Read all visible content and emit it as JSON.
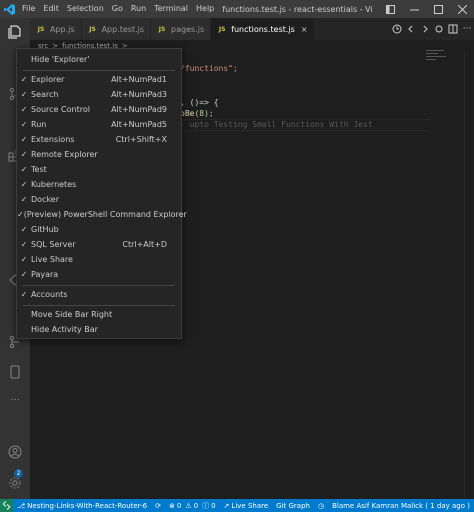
{
  "titlebar": {
    "menu": [
      "File",
      "Edit",
      "Selection",
      "Go",
      "Run",
      "Terminal",
      "Help"
    ],
    "title": "functions.test.js - react-essentials - Visual Studi...",
    "ctrl_icons": [
      "layout-icon",
      "minimize-icon",
      "maximize-icon",
      "close-icon"
    ]
  },
  "tabs": [
    {
      "label": "App.js",
      "icon": "js-icon"
    },
    {
      "label": "App.test.js",
      "icon": "js-icon"
    },
    {
      "label": "pages.js",
      "icon": "js-icon"
    },
    {
      "label": "functions.test.js",
      "icon": "js-icon",
      "active": true,
      "close": "×"
    }
  ],
  "breadcrumb": [
    "src",
    ">",
    "functions.test.js",
    ">"
  ],
  "code": {
    "line1": "/functions\";",
    "line2": ", ()=> {",
    "line3_fn": "oBe",
    "line3_rest": "(8);",
    "ghost": "- upto Testing Small Functions With Jest"
  },
  "context_menu": {
    "hide_explorer": "Hide 'Explorer'",
    "items": [
      {
        "label": "Explorer",
        "shortcut": "Alt+NumPad1",
        "checked": true
      },
      {
        "label": "Search",
        "shortcut": "Alt+NumPad3",
        "checked": true
      },
      {
        "label": "Source Control",
        "shortcut": "Alt+NumPad9",
        "checked": true
      },
      {
        "label": "Run",
        "shortcut": "Alt+NumPad5",
        "checked": true
      },
      {
        "label": "Extensions",
        "shortcut": "Ctrl+Shift+X",
        "checked": true
      },
      {
        "label": "Remote Explorer",
        "shortcut": "",
        "checked": true
      },
      {
        "label": "Test",
        "shortcut": "",
        "checked": true
      },
      {
        "label": "Kubernetes",
        "shortcut": "",
        "checked": true
      },
      {
        "label": "Docker",
        "shortcut": "",
        "checked": true
      },
      {
        "label": "(Preview) PowerShell Command Explorer",
        "shortcut": "",
        "checked": true
      },
      {
        "label": "GitHub",
        "shortcut": "",
        "checked": true
      },
      {
        "label": "SQL Server",
        "shortcut": "Ctrl+Alt+D",
        "checked": true
      },
      {
        "label": "Live Share",
        "shortcut": "",
        "checked": true
      },
      {
        "label": "Payara",
        "shortcut": "",
        "checked": true
      }
    ],
    "accounts": {
      "label": "Accounts",
      "checked": true
    },
    "move_side_bar": "Move Side Bar Right",
    "hide_activity_bar": "Hide Activity Bar",
    "check_glyph": "✓"
  },
  "activity_bar": {
    "icons": [
      "explorer-icon",
      "search-icon",
      "source-control-icon",
      "run-icon",
      "extensions-icon",
      "remote-explorer-icon",
      "test-icon",
      "kubernetes-icon",
      "docker-icon",
      "powershell-icon",
      "github-icon",
      "sql-server-icon",
      "live-share-icon",
      "payara-icon",
      "more-icon",
      "accounts-icon",
      "settings-icon"
    ],
    "accounts_badge": "2",
    "more": "···"
  },
  "statusbar": {
    "branch": "Nesting-Links-With-React-Router-6",
    "errors": "0",
    "warnings": "0",
    "info": "0",
    "live_share": "Live Share",
    "git_graph": "Git Graph",
    "blame": "Blame Asif Kamran Malick ( 1 day ago )"
  },
  "colors": {
    "accent": "#007acc",
    "remote": "#16825d",
    "menu_bg": "#252526",
    "title_bg": "#3c3c3c",
    "activity_bg": "#333333"
  }
}
